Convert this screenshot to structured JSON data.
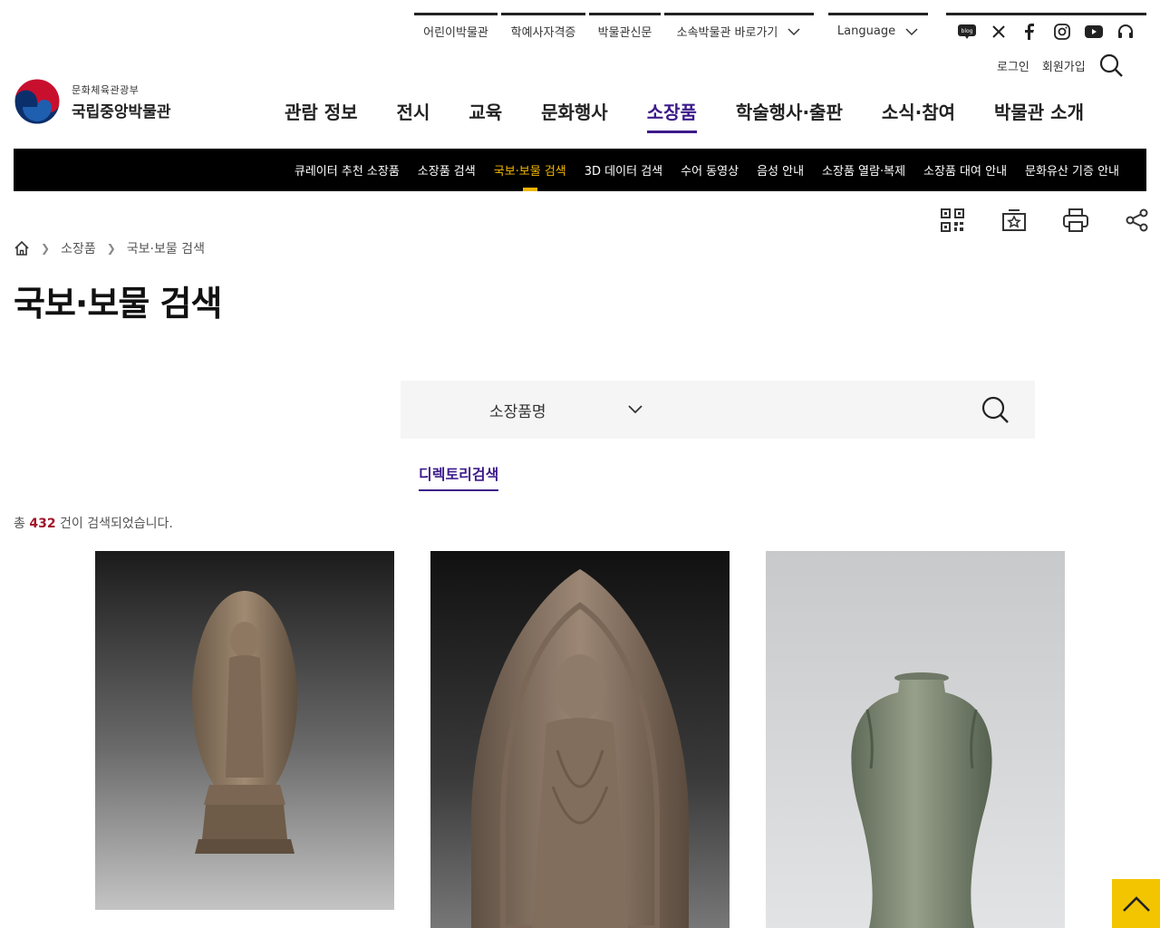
{
  "utility": {
    "links": [
      "어린이박물관",
      "학예사자격증",
      "박물관신문",
      "소속박물관 바로가기"
    ],
    "language": "Language",
    "sns_icons": [
      "blog-icon",
      "x-icon",
      "facebook-icon",
      "instagram-icon",
      "youtube-icon",
      "headset-icon"
    ],
    "sns_blog_text": "blog",
    "login": "로그인",
    "join": "회원가입"
  },
  "logo": {
    "ministry": "문화체육관광부",
    "museum": "국립중앙박물관"
  },
  "gnb": [
    "관람 정보",
    "전시",
    "교육",
    "문화행사",
    "소장품",
    "학술행사·출판",
    "소식·참여",
    "박물관 소개"
  ],
  "gnb_active": "소장품",
  "subnav": [
    "큐레이터 추천 소장품",
    "소장품 검색",
    "국보·보물 검색",
    "3D 데이터 검색",
    "수어 동영상",
    "음성 안내",
    "소장품 열람·복제",
    "소장품 대여 안내",
    "문화유산 기증 안내"
  ],
  "subnav_active": "국보·보물 검색",
  "breadcrumb": [
    "소장품",
    "국보·보물 검색"
  ],
  "page_title": "국보·보물 검색",
  "search": {
    "select_value": "소장품명",
    "input_value": ""
  },
  "directory_tab": "디렉토리검색",
  "result": {
    "prefix": "총",
    "count": "432",
    "suffix": "건이 검색되었습니다."
  },
  "colors": {
    "accent": "#3d1a8a",
    "highlight": "#f2b600",
    "count": "#a0142a"
  }
}
